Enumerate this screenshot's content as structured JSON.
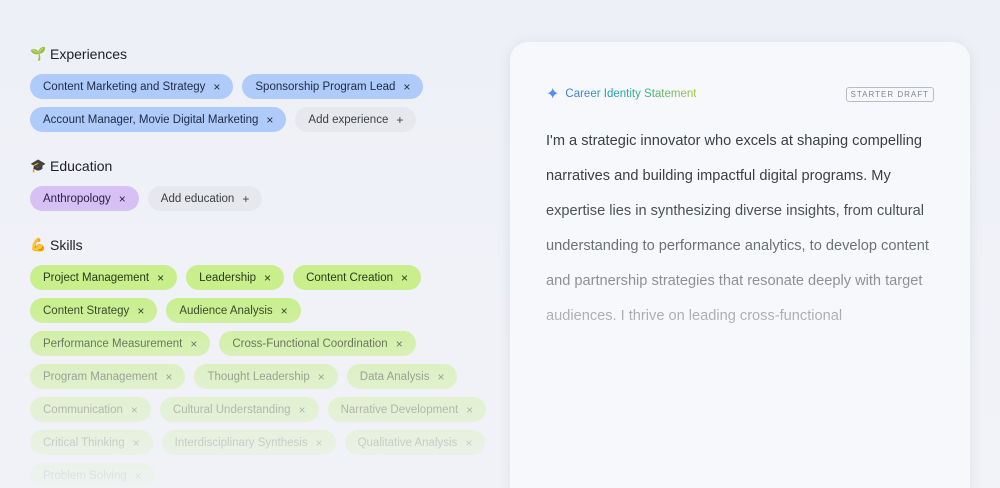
{
  "experiences": {
    "title": "Experiences",
    "emoji": "🌱",
    "items": [
      "Content Marketing and Strategy",
      "Sponsorship Program Lead",
      "Account Manager, Movie Digital Marketing"
    ],
    "add_label": "Add experience"
  },
  "education": {
    "title": "Education",
    "emoji": "🎓",
    "items": [
      "Anthropology"
    ],
    "add_label": "Add education"
  },
  "skills": {
    "title": "Skills",
    "emoji": "💪",
    "items": [
      "Project Management",
      "Leadership",
      "Content Creation",
      "Content Strategy",
      "Audience Analysis",
      "Performance Measurement",
      "Cross-Functional Coordination",
      "Program Management",
      "Thought Leadership",
      "Data Analysis",
      "Communication",
      "Cultural Understanding",
      "Narrative Development",
      "Critical Thinking",
      "Interdisciplinary Synthesis",
      "Qualitative Analysis",
      "Problem Solving"
    ]
  },
  "remove_glyph": "×",
  "add_glyph": "+",
  "card": {
    "title": "Career Identity Statement",
    "badge": "STARTER DRAFT",
    "statement": "I'm a strategic innovator who excels at shaping compelling narratives and building impactful digital programs. My expertise lies in synthesizing diverse insights, from cultural understanding to performance analytics, to develop content and partnership strategies that resonate deeply with target audiences. I thrive on leading cross-functional"
  }
}
